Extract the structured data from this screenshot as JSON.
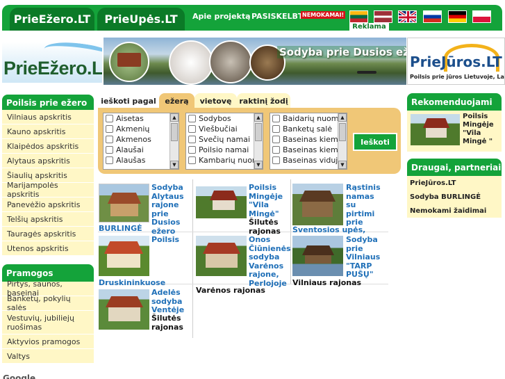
{
  "nav": {
    "tab1": "PrieEžero.LT",
    "tab2": "PrieUpės.LT",
    "about": "Apie projektą",
    "advertise": "PASISKELBTI",
    "free_badge": "NEMOKAMAI!",
    "ad_label": "Reklama",
    "flags": [
      "lithuania-flag-icon",
      "latvia-flag-icon",
      "uk-flag-icon",
      "russia-flag-icon",
      "germany-flag-icon",
      "poland-flag-icon"
    ]
  },
  "banners": {
    "logo_left": "PrieEžero.L",
    "center_text": "Sodyba prie Dusios ež",
    "logo_right": "PrieJūros.LT",
    "logo_right_sub": "Poilsis prie jūros Lietuvoje, Latvij"
  },
  "sidebar": {
    "section1_title": "Poilsis prie ežero",
    "regions": [
      "Vilniaus apskritis",
      "Kauno apskritis",
      "Klaipėdos apskritis",
      "Alytaus apskritis",
      "Šiaulių apskritis",
      "Marijampolės apskritis",
      "Panevėžio apskritis",
      "Telšių apskritis",
      "Tauragės apskritis",
      "Utenos apskritis"
    ],
    "section2_title": "Pramogos",
    "entertainment": [
      "Pirtys, saunos, baseinai",
      "Banketų, pokylių salės",
      "Vestuvių, jubiliejų ruošimas",
      "Aktyvios pramogos",
      "Valtys"
    ],
    "google_text": "Google"
  },
  "search": {
    "label": "ieškoti pagal",
    "tabs": [
      "ežerą",
      "vietovę",
      "raktinį žodį"
    ],
    "lakes": [
      "Aisetas",
      "Akmenių",
      "Akmenos",
      "Alaušai",
      "Alaušas"
    ],
    "types": [
      "Sodybos",
      "Viešbučiai",
      "Svečių namai",
      "Poilsio namai",
      "Kambarių nuom"
    ],
    "facilities": [
      "Baidarių nuoma",
      "Banketų salė",
      "Baseinas kieme",
      "Baseinas kieme",
      "Baseinas viduje"
    ],
    "button": "Ieškoti"
  },
  "listings": [
    {
      "title": "Sodyba Alytaus rajone prie Dusios ežero",
      "region": "BURLINGĖ"
    },
    {
      "title": "Poilsis Mingėje \"Vila Mingė\"",
      "region": "Šilutės rajonas"
    },
    {
      "title": "Rąstinis namas su pirtimi prie",
      "region": "Šventosios upės, kaime"
    },
    {
      "title": "Poilsis",
      "region": "Druskininkuose"
    },
    {
      "title": "Onos Čiūnienės sodyba Varėnos rajone, Perlojoje",
      "region": "Varėnos rajonas"
    },
    {
      "title": "Sodyba prie Vilniaus \"TARP PUŠŲ\"",
      "region": "Vilniaus rajonas"
    },
    {
      "title": "Adelės sodyba Ventėje",
      "region": "Šilutės rajonas"
    }
  ],
  "right": {
    "recommended_title": "Rekomenduojami",
    "recommended_item": "Poilsis Mingėje \"Vila Mingė \"",
    "friends_title": "Draugai, partneriai",
    "friends": [
      "PrieJūros.LT",
      "Sodyba BURLINGĖ",
      "Nemokami žaidimai"
    ]
  },
  "colors": {
    "brand_green": "#14a33a",
    "dark_green": "#0b7a27",
    "cream": "#fff7c6",
    "tab_orange": "#f0c777",
    "link_blue": "#2070b8"
  }
}
